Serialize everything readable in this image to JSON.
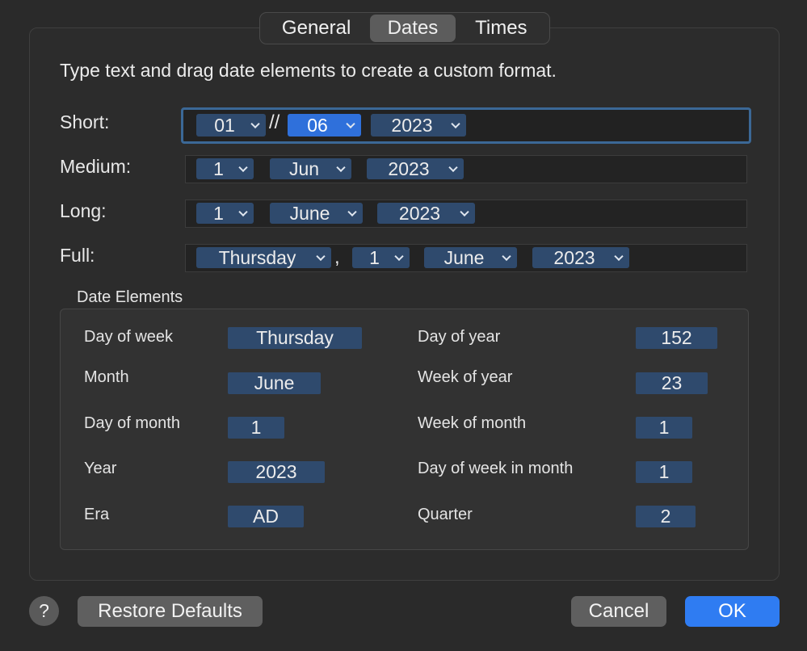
{
  "tabs": {
    "general": "General",
    "dates": "Dates",
    "times": "Times"
  },
  "instruction": "Type text and drag date elements to create a custom format.",
  "formats": {
    "short": {
      "label": "Short:",
      "day": "01",
      "separator": "//",
      "month": "06",
      "year": "2023"
    },
    "medium": {
      "label": "Medium:",
      "day": "1",
      "month": "Jun",
      "year": "2023"
    },
    "long": {
      "label": "Long:",
      "day": "1",
      "month": "June",
      "year": "2023"
    },
    "full": {
      "label": "Full:",
      "weekday": "Thursday",
      "separator": ",",
      "day": "1",
      "month": "June",
      "year": "2023"
    }
  },
  "date_elements": {
    "title": "Date Elements",
    "day_of_week": {
      "label": "Day of week",
      "value": "Thursday"
    },
    "month": {
      "label": "Month",
      "value": "June"
    },
    "day_of_month": {
      "label": "Day of month",
      "value": "1"
    },
    "year": {
      "label": "Year",
      "value": "2023"
    },
    "era": {
      "label": "Era",
      "value": "AD"
    },
    "day_of_year": {
      "label": "Day of year",
      "value": "152"
    },
    "week_of_year": {
      "label": "Week of year",
      "value": "23"
    },
    "week_of_month": {
      "label": "Week of month",
      "value": "1"
    },
    "day_of_week_in_month": {
      "label": "Day of week in month",
      "value": "1"
    },
    "quarter": {
      "label": "Quarter",
      "value": "2"
    }
  },
  "buttons": {
    "help": "?",
    "restore": "Restore Defaults",
    "cancel": "Cancel",
    "ok": "OK"
  },
  "colors": {
    "accent": "#2f7cf2",
    "token": "#2f4a6d",
    "token_selected": "#2f70db",
    "focus_ring": "#3b6896"
  }
}
